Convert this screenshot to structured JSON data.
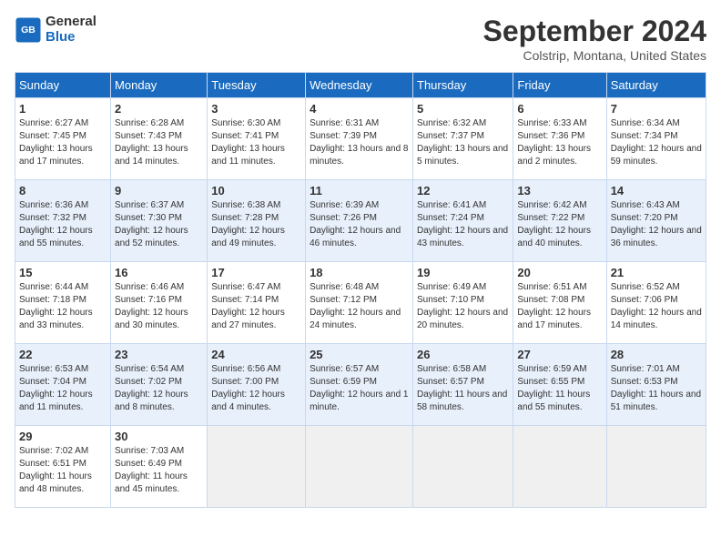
{
  "header": {
    "logo_general": "General",
    "logo_blue": "Blue",
    "month_title": "September 2024",
    "location": "Colstrip, Montana, United States"
  },
  "calendar": {
    "weekdays": [
      "Sunday",
      "Monday",
      "Tuesday",
      "Wednesday",
      "Thursday",
      "Friday",
      "Saturday"
    ],
    "weeks": [
      [
        {
          "day": "1",
          "sunrise": "6:27 AM",
          "sunset": "7:45 PM",
          "daylight": "13 hours and 17 minutes."
        },
        {
          "day": "2",
          "sunrise": "6:28 AM",
          "sunset": "7:43 PM",
          "daylight": "13 hours and 14 minutes."
        },
        {
          "day": "3",
          "sunrise": "6:30 AM",
          "sunset": "7:41 PM",
          "daylight": "13 hours and 11 minutes."
        },
        {
          "day": "4",
          "sunrise": "6:31 AM",
          "sunset": "7:39 PM",
          "daylight": "13 hours and 8 minutes."
        },
        {
          "day": "5",
          "sunrise": "6:32 AM",
          "sunset": "7:37 PM",
          "daylight": "13 hours and 5 minutes."
        },
        {
          "day": "6",
          "sunrise": "6:33 AM",
          "sunset": "7:36 PM",
          "daylight": "13 hours and 2 minutes."
        },
        {
          "day": "7",
          "sunrise": "6:34 AM",
          "sunset": "7:34 PM",
          "daylight": "12 hours and 59 minutes."
        }
      ],
      [
        {
          "day": "8",
          "sunrise": "6:36 AM",
          "sunset": "7:32 PM",
          "daylight": "12 hours and 55 minutes."
        },
        {
          "day": "9",
          "sunrise": "6:37 AM",
          "sunset": "7:30 PM",
          "daylight": "12 hours and 52 minutes."
        },
        {
          "day": "10",
          "sunrise": "6:38 AM",
          "sunset": "7:28 PM",
          "daylight": "12 hours and 49 minutes."
        },
        {
          "day": "11",
          "sunrise": "6:39 AM",
          "sunset": "7:26 PM",
          "daylight": "12 hours and 46 minutes."
        },
        {
          "day": "12",
          "sunrise": "6:41 AM",
          "sunset": "7:24 PM",
          "daylight": "12 hours and 43 minutes."
        },
        {
          "day": "13",
          "sunrise": "6:42 AM",
          "sunset": "7:22 PM",
          "daylight": "12 hours and 40 minutes."
        },
        {
          "day": "14",
          "sunrise": "6:43 AM",
          "sunset": "7:20 PM",
          "daylight": "12 hours and 36 minutes."
        }
      ],
      [
        {
          "day": "15",
          "sunrise": "6:44 AM",
          "sunset": "7:18 PM",
          "daylight": "12 hours and 33 minutes."
        },
        {
          "day": "16",
          "sunrise": "6:46 AM",
          "sunset": "7:16 PM",
          "daylight": "12 hours and 30 minutes."
        },
        {
          "day": "17",
          "sunrise": "6:47 AM",
          "sunset": "7:14 PM",
          "daylight": "12 hours and 27 minutes."
        },
        {
          "day": "18",
          "sunrise": "6:48 AM",
          "sunset": "7:12 PM",
          "daylight": "12 hours and 24 minutes."
        },
        {
          "day": "19",
          "sunrise": "6:49 AM",
          "sunset": "7:10 PM",
          "daylight": "12 hours and 20 minutes."
        },
        {
          "day": "20",
          "sunrise": "6:51 AM",
          "sunset": "7:08 PM",
          "daylight": "12 hours and 17 minutes."
        },
        {
          "day": "21",
          "sunrise": "6:52 AM",
          "sunset": "7:06 PM",
          "daylight": "12 hours and 14 minutes."
        }
      ],
      [
        {
          "day": "22",
          "sunrise": "6:53 AM",
          "sunset": "7:04 PM",
          "daylight": "12 hours and 11 minutes."
        },
        {
          "day": "23",
          "sunrise": "6:54 AM",
          "sunset": "7:02 PM",
          "daylight": "12 hours and 8 minutes."
        },
        {
          "day": "24",
          "sunrise": "6:56 AM",
          "sunset": "7:00 PM",
          "daylight": "12 hours and 4 minutes."
        },
        {
          "day": "25",
          "sunrise": "6:57 AM",
          "sunset": "6:59 PM",
          "daylight": "12 hours and 1 minute."
        },
        {
          "day": "26",
          "sunrise": "6:58 AM",
          "sunset": "6:57 PM",
          "daylight": "11 hours and 58 minutes."
        },
        {
          "day": "27",
          "sunrise": "6:59 AM",
          "sunset": "6:55 PM",
          "daylight": "11 hours and 55 minutes."
        },
        {
          "day": "28",
          "sunrise": "7:01 AM",
          "sunset": "6:53 PM",
          "daylight": "11 hours and 51 minutes."
        }
      ],
      [
        {
          "day": "29",
          "sunrise": "7:02 AM",
          "sunset": "6:51 PM",
          "daylight": "11 hours and 48 minutes."
        },
        {
          "day": "30",
          "sunrise": "7:03 AM",
          "sunset": "6:49 PM",
          "daylight": "11 hours and 45 minutes."
        },
        null,
        null,
        null,
        null,
        null
      ]
    ]
  }
}
